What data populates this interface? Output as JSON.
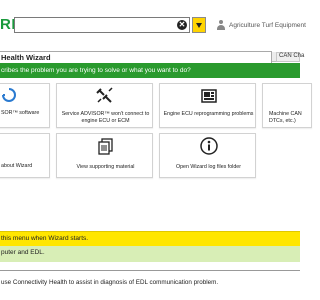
{
  "app": {
    "logo_text": "RE",
    "brand_color": "#1a9a3c"
  },
  "header": {
    "search_placeholder": "",
    "user_name": "Agriculture Turf Equipment"
  },
  "tabs": {
    "active_label": "Health Wizard",
    "other_label": "CAN Cha"
  },
  "banner": {
    "question": "cribes the problem you are trying to solve or what you want to do?"
  },
  "cards": [
    {
      "label": "SOR™ software"
    },
    {
      "label": "Service ADVISOR™ won't connect to engine ECU or ECM"
    },
    {
      "label": "Engine ECU reprogramming problems"
    },
    {
      "label": "Machine CAN DTCs, etc.)"
    },
    {
      "label": "about Wizard"
    },
    {
      "label": "View supporting material"
    },
    {
      "label": "Open Wizard log files folder"
    }
  ],
  "yellow_bar": {
    "label": "this menu when Wizard starts."
  },
  "green_area": {
    "text": "puter and EDL."
  },
  "footer": {
    "text": "use Connectivity Health to assist in diagnosis of EDL communication problem."
  }
}
